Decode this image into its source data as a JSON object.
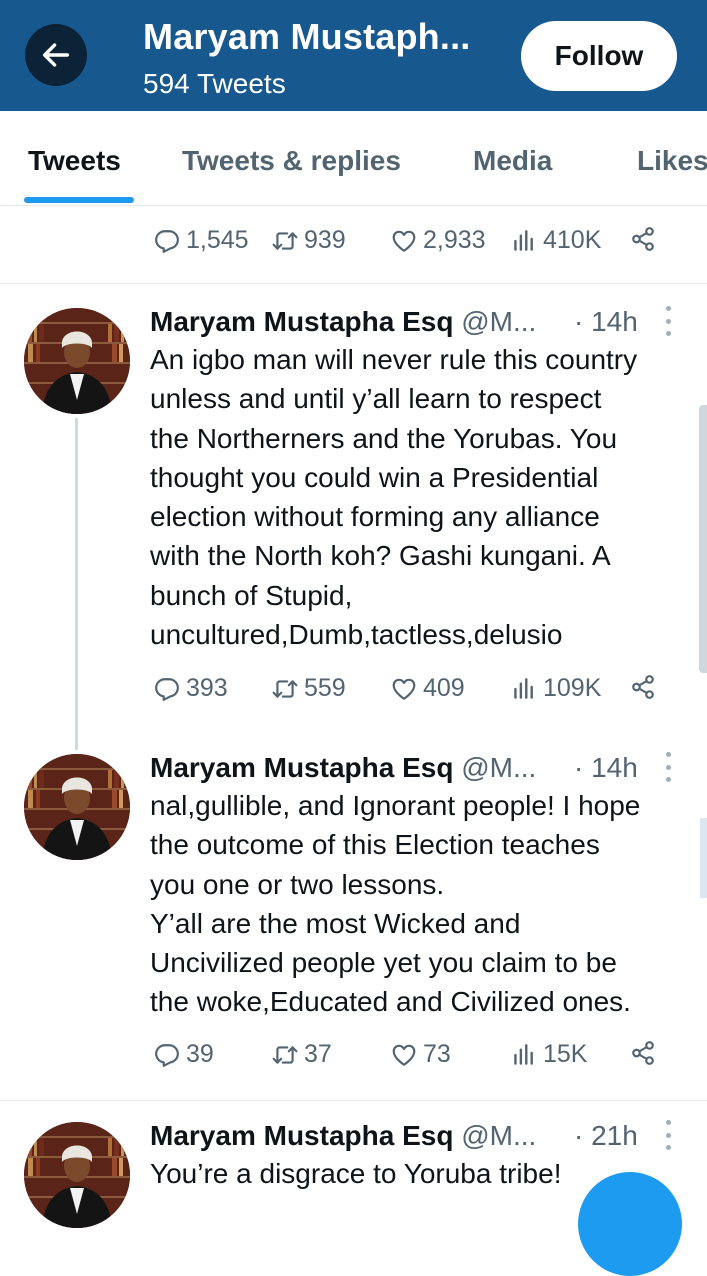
{
  "header": {
    "name": "Maryam Mustaph...",
    "tweet_count": "594 Tweets",
    "follow_label": "Follow"
  },
  "tabs": [
    "Tweets",
    "Tweets & replies",
    "Media",
    "Likes"
  ],
  "top_actions": {
    "replies": "1,545",
    "retweets": "939",
    "likes": "2,933",
    "views": "410K"
  },
  "tweets": [
    {
      "name": "Maryam Mustapha Esq",
      "handle": "@M...",
      "time": "· 14h",
      "text": "An igbo man will never rule this country\nunless and until y’all learn to respect\nthe Northerners and the Yorubas. You\nthought you could win a Presidential\nelection without forming any alliance\nwith the North koh? Gashi kungani. A\nbunch of Stupid,\nuncultured,Dumb,tactless,delusio",
      "replies": "393",
      "retweets": "559",
      "likes": "409",
      "views": "109K"
    },
    {
      "name": "Maryam Mustapha Esq",
      "handle": "@M...",
      "time": "· 14h",
      "text": "nal,gullible, and Ignorant people! I hope\nthe outcome of this Election teaches\nyou one or two lessons.\nY’all are the most Wicked and\nUncivilized people yet you claim to be\nthe woke,Educated and Civilized ones.",
      "replies": "39",
      "retweets": "37",
      "likes": "73",
      "views": "15K"
    },
    {
      "name": "Maryam Mustapha Esq",
      "handle": "@M...",
      "time": "· 21h",
      "text": "You’re a disgrace to Yoruba tribe!"
    }
  ],
  "colors": {
    "header_bg": "#17588f",
    "accent": "#1d9bf0",
    "muted": "#536471"
  },
  "icons": [
    "back-arrow-icon",
    "reply-icon",
    "retweet-icon",
    "like-icon",
    "views-icon",
    "share-icon",
    "more-icon"
  ]
}
